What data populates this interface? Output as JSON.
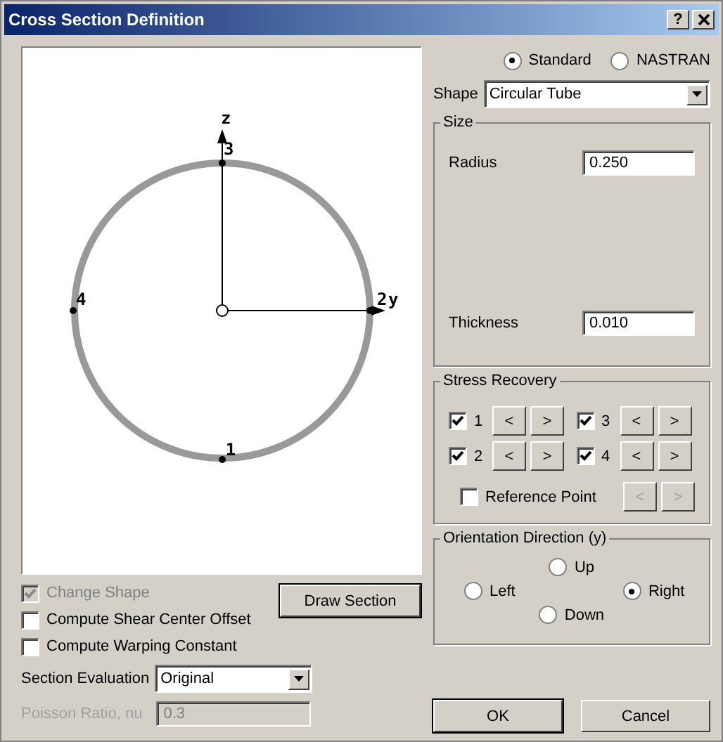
{
  "window": {
    "title": "Cross Section Definition",
    "help_button": "?"
  },
  "section_view": {
    "z_label": "z",
    "y_label": "y",
    "points": [
      {
        "label": "1"
      },
      {
        "label": "2"
      },
      {
        "label": "3"
      },
      {
        "label": "4"
      }
    ]
  },
  "format": [
    {
      "label": "Standard",
      "selected": true
    },
    {
      "label": "NASTRAN",
      "selected": false
    }
  ],
  "shape": {
    "label": "Shape",
    "value": "Circular Tube"
  },
  "size": {
    "title": "Size",
    "fields": [
      {
        "label": "Radius",
        "value": "0.250"
      },
      {
        "label": "Thickness",
        "value": "0.010"
      }
    ]
  },
  "stress_recovery": {
    "title": "Stress Recovery",
    "points": [
      {
        "label": "1",
        "checked": true,
        "prev": "<",
        "next": ">"
      },
      {
        "label": "2",
        "checked": true,
        "prev": "<",
        "next": ">"
      },
      {
        "label": "3",
        "checked": true,
        "prev": "<",
        "next": ">"
      },
      {
        "label": "4",
        "checked": true,
        "prev": "<",
        "next": ">"
      }
    ],
    "reference_point": {
      "label": "Reference Point",
      "checked": false,
      "prev": "<",
      "next": ">",
      "disabled": true
    }
  },
  "orientation": {
    "title": "Orientation Direction (y)",
    "options": [
      {
        "label": "Up",
        "selected": false
      },
      {
        "label": "Left",
        "selected": false
      },
      {
        "label": "Right",
        "selected": true
      },
      {
        "label": "Down",
        "selected": false
      }
    ]
  },
  "options": [
    {
      "label": "Change Shape",
      "checked": true,
      "disabled": true
    },
    {
      "label": "Compute Shear Center Offset",
      "checked": false,
      "disabled": false
    },
    {
      "label": "Compute Warping Constant",
      "checked": false,
      "disabled": false
    }
  ],
  "draw_button": "Draw Section",
  "section_evaluation": {
    "label": "Section Evaluation",
    "value": "Original"
  },
  "poisson": {
    "label": "Poisson Ratio, nu",
    "value": "0.3",
    "disabled": true
  },
  "buttons": [
    "OK",
    "Cancel"
  ]
}
